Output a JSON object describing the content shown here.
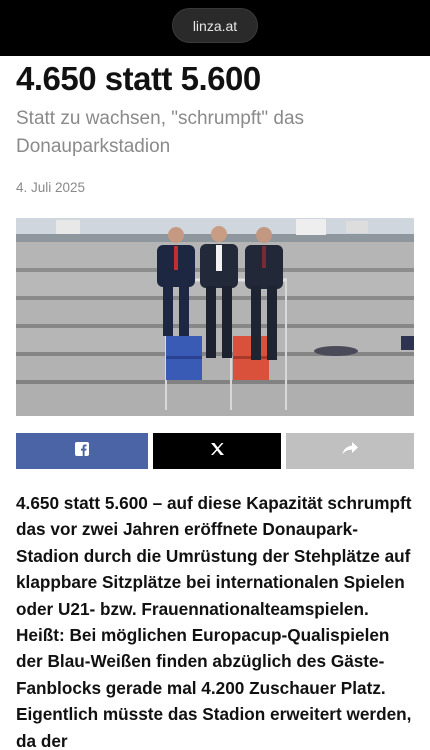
{
  "browser": {
    "url": "linza.at"
  },
  "article": {
    "headline": "4.650 statt 5.600",
    "subheadline": "Statt zu wachsen, \"schrumpft\" das Donauparkstadion",
    "date": "4. Juli 2025",
    "body": "4.650 statt 5.600 – auf diese Kapazität schrumpft das vor zwei Jahren eröffnete Donaupark-Stadion durch die Umrüstung der Stehplätze auf klappbare Sitzplätze bei internationalen Spielen oder U21- bzw. Frauennationalteamspielen. Heißt: Bei möglichen Europacup-Qualispielen der Blau-Weißen finden abzüglich des Gäste-Fanblocks gerade mal 4.200 Zuschauer Platz. Eigentlich müsste das Stadion erweitert werden, da der"
  },
  "share": {
    "facebook_icon": "facebook-icon",
    "x_icon": "x-icon",
    "share_icon": "share-arrow-icon",
    "colors": {
      "facebook": "#4a64a5",
      "x": "#000000",
      "share": "#c0c0c0"
    }
  },
  "photo": {
    "icon": "stadium-photo"
  }
}
